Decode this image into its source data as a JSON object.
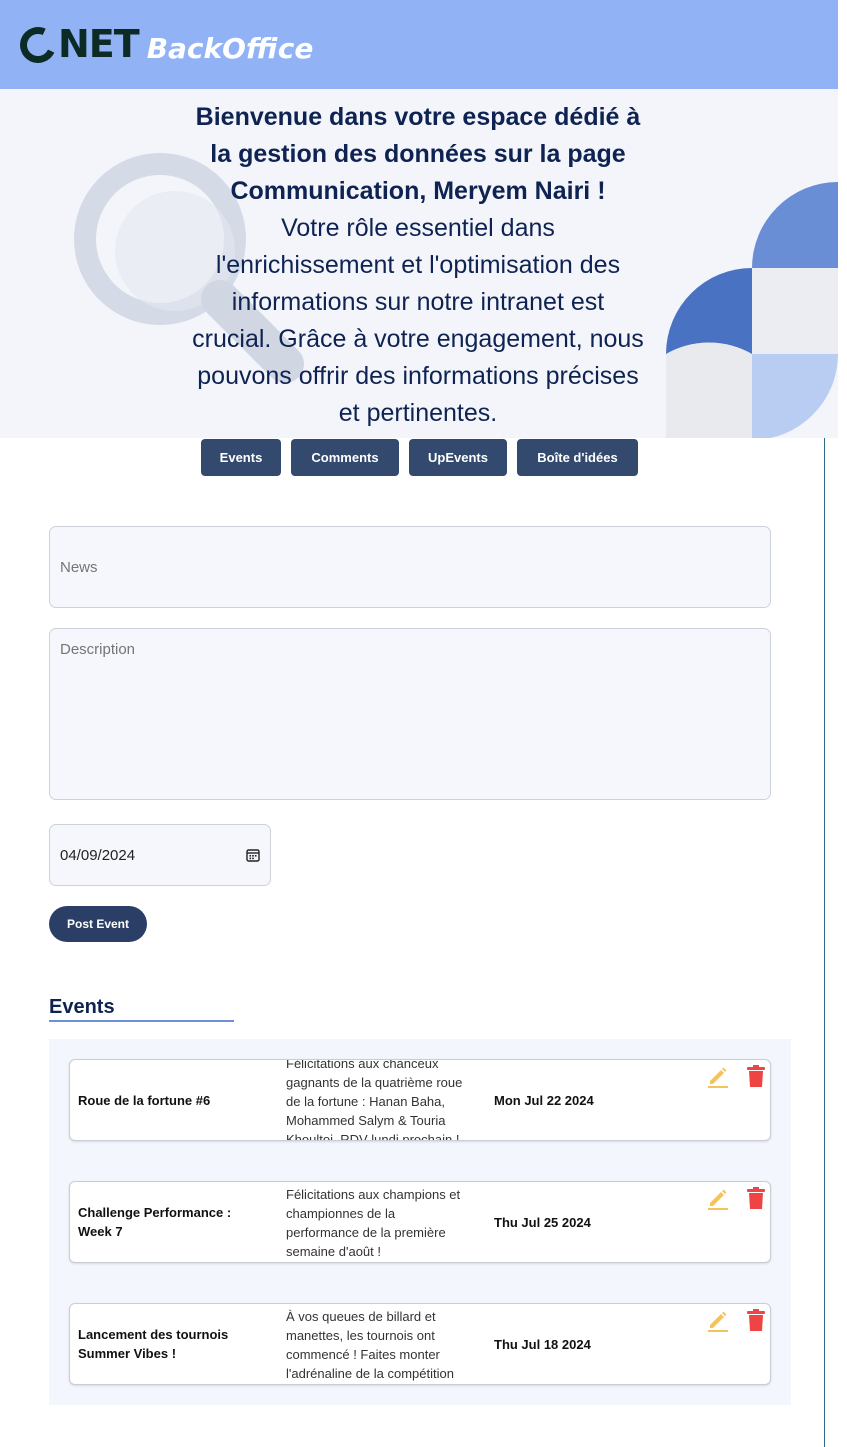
{
  "header": {
    "logo_net": "NET",
    "logo_sub": "BackOffice",
    "bg_color": "#91b2f5"
  },
  "hero": {
    "title_lines": [
      "Bienvenue dans votre espace dédié à",
      "la gestion des données sur la page",
      "Communication, Meryem Nairi !"
    ],
    "body_lines": [
      "Votre rôle essentiel dans",
      "l'enrichissement et l'optimisation des",
      "informations sur notre intranet est",
      "crucial. Grâce à votre engagement, nous",
      "pouvons offrir des informations précises",
      "et pertinentes."
    ]
  },
  "tabs": [
    {
      "label": "Events"
    },
    {
      "label": "Comments"
    },
    {
      "label": "UpEvents"
    },
    {
      "label": "Boîte d'idées"
    }
  ],
  "form": {
    "news_placeholder": "News",
    "description_placeholder": "Description",
    "date_value": "04/09/2024",
    "post_label": "Post Event"
  },
  "events": {
    "section_title": "Events",
    "items": [
      {
        "title": "Roue de la fortune #6",
        "description_lines": [
          "Félicitations aux chanceux",
          "gagnants de la quatrième roue",
          "de la fortune : Hanan Baha,",
          "Mohammed Salym & Touria",
          "Khoultoi. RDV lundi prochain !"
        ],
        "date": "Mon Jul 22 2024"
      },
      {
        "title": "Challenge Performance : Week 7",
        "description_lines": [
          "Félicitations aux champions et",
          "championnes de la",
          "performance de la première",
          "semaine d'août !"
        ],
        "date": "Thu Jul 25 2024"
      },
      {
        "title": "Lancement des tournois Summer Vibes !",
        "description_lines": [
          "À vos queues de billard et",
          "manettes, les tournois ont",
          "commencé ! Faites monter",
          "l'adrénaline de la compétition"
        ],
        "date": "Thu Jul 18 2024"
      }
    ]
  },
  "icons": {
    "edit": "pencil-icon",
    "delete": "trash-icon",
    "calendar": "calendar-icon",
    "edit_color": "#f5c35c",
    "delete_color": "#ef4444"
  }
}
